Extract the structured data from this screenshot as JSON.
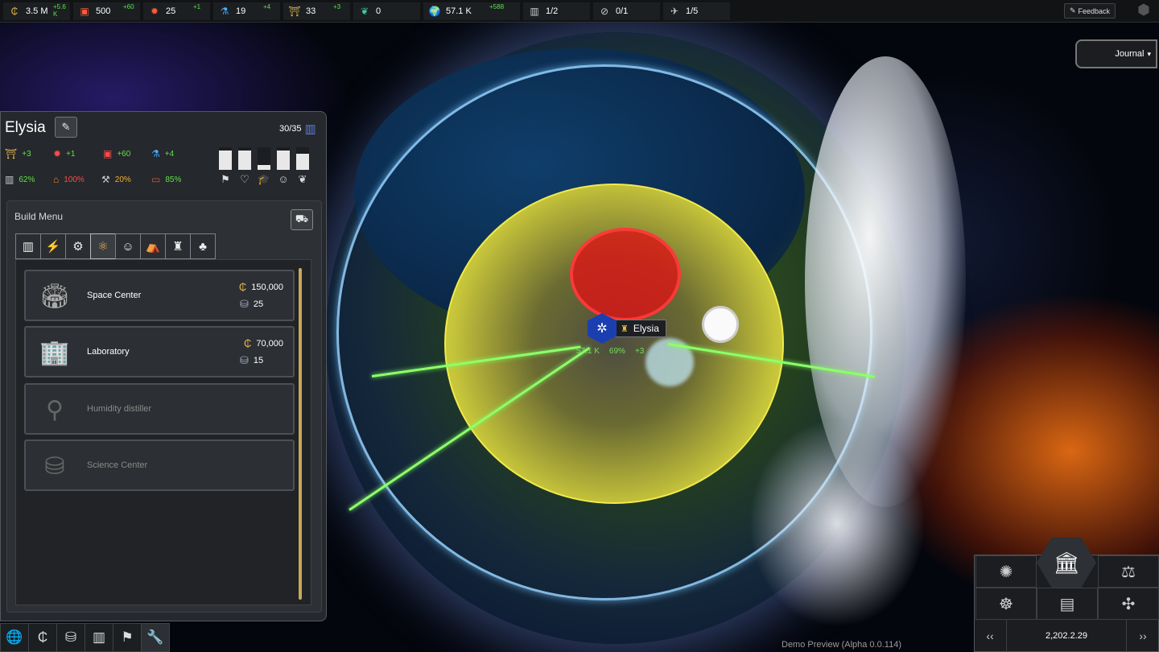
{
  "topbar": {
    "resources": [
      {
        "icon": "credits-icon",
        "glyph": "₵",
        "value": "3.5 M",
        "delta": "+5.6 K",
        "color": "#e6b84a"
      },
      {
        "icon": "materials-icon",
        "glyph": "▣",
        "value": "500",
        "delta": "+60",
        "color": "#ff5a3a"
      },
      {
        "icon": "technology-icon",
        "glyph": "✹",
        "value": "25",
        "delta": "+1",
        "color": "#ff5a3a"
      },
      {
        "icon": "research-icon",
        "glyph": "⚗",
        "value": "19",
        "delta": "+4",
        "color": "#4ab0ff"
      },
      {
        "icon": "influence-icon",
        "glyph": "⛩",
        "value": "33",
        "delta": "+3",
        "color": "#e6b84a"
      },
      {
        "icon": "crops-icon",
        "glyph": "❦",
        "value": "0",
        "delta": "",
        "color": "#3ad0a0"
      },
      {
        "icon": "population-globe-icon",
        "glyph": "🌍",
        "value": "57.1 K",
        "delta": "+588",
        "color": "#5ee04a"
      },
      {
        "icon": "cities-icon",
        "glyph": "▥",
        "value": "1/2",
        "delta": "",
        "color": "#cccccc"
      },
      {
        "icon": "colonies-icon",
        "glyph": "⊘",
        "value": "0/1",
        "delta": "",
        "color": "#cccccc"
      },
      {
        "icon": "ships-icon",
        "glyph": "✈",
        "value": "1/5",
        "delta": "",
        "color": "#cccccc"
      }
    ],
    "feedback_label": "Feedback"
  },
  "journal_label": "Journal",
  "city_tag": {
    "name": "Elysia",
    "population": "57.1 K",
    "approval": "69%",
    "influence": "+3"
  },
  "panel": {
    "city_name": "Elysia",
    "population": "30/35",
    "stats_row1": [
      {
        "icon": "influence-icon",
        "glyph": "⛩",
        "value": "+3",
        "cls": "g",
        "iconcls": "y"
      },
      {
        "icon": "technology-icon",
        "glyph": "✹",
        "value": "+1",
        "cls": "g",
        "iconcls": "r"
      },
      {
        "icon": "materials-icon",
        "glyph": "▣",
        "value": "+60",
        "cls": "g",
        "iconcls": "r"
      },
      {
        "icon": "research-icon",
        "glyph": "⚗",
        "value": "+4",
        "cls": "g",
        "iconcls": "b"
      }
    ],
    "stats_row2": [
      {
        "icon": "housing-icon",
        "glyph": "▥",
        "value": "62%",
        "cls": "g"
      },
      {
        "icon": "commerce-icon",
        "glyph": "⌂",
        "value": "100%",
        "cls": "r"
      },
      {
        "icon": "industry-icon",
        "glyph": "⚒",
        "value": "20%",
        "cls": "o"
      },
      {
        "icon": "jobs-icon",
        "glyph": "▭",
        "value": "85%",
        "cls": "g"
      }
    ],
    "needs_bars": [
      {
        "icon": "security-icon",
        "glyph": "⚑",
        "level": 0.85
      },
      {
        "icon": "health-icon",
        "glyph": "♡",
        "level": 0.85
      },
      {
        "icon": "education-icon",
        "glyph": "🎓",
        "level": 0.2
      },
      {
        "icon": "entertainment-icon",
        "glyph": "☺",
        "level": 0.85
      },
      {
        "icon": "nature-icon",
        "glyph": "❦",
        "level": 0.7
      }
    ],
    "build_menu_title": "Build Menu",
    "tabs": [
      {
        "icon": "housing-tab-icon",
        "glyph": "▥"
      },
      {
        "icon": "energy-tab-icon",
        "glyph": "⚡"
      },
      {
        "icon": "industry-tab-icon",
        "glyph": "⚙"
      },
      {
        "icon": "science-tab-icon",
        "glyph": "⚛"
      },
      {
        "icon": "entertainment-tab-icon",
        "glyph": "☺"
      },
      {
        "icon": "health-tab-icon",
        "glyph": "⛺"
      },
      {
        "icon": "monument-tab-icon",
        "glyph": "♜"
      },
      {
        "icon": "nature-tab-icon",
        "glyph": "♣"
      }
    ],
    "buildings": [
      {
        "name": "Space Center",
        "credits": "150,000",
        "workers": "25",
        "enabled": true,
        "icon": "space-center-icon",
        "glyph": "🏟"
      },
      {
        "name": "Laboratory",
        "credits": "70,000",
        "workers": "15",
        "enabled": true,
        "icon": "laboratory-icon",
        "glyph": "🏢"
      },
      {
        "name": "Humidity distiller",
        "credits": "",
        "workers": "",
        "enabled": false,
        "icon": "humidity-distiller-icon",
        "glyph": "⚲"
      },
      {
        "name": "Science Center",
        "credits": "",
        "workers": "",
        "enabled": false,
        "icon": "science-center-icon",
        "glyph": "⛁"
      }
    ]
  },
  "bottom_nav": [
    {
      "icon": "planet-icon",
      "glyph": "🌐"
    },
    {
      "icon": "credits-icon",
      "glyph": "₵"
    },
    {
      "icon": "resources-icon",
      "glyph": "⛁"
    },
    {
      "icon": "cities-icon",
      "glyph": "▥"
    },
    {
      "icon": "flags-icon",
      "glyph": "⚑"
    },
    {
      "icon": "build-tools-icon",
      "glyph": "🔧"
    }
  ],
  "right_panel": {
    "buttons": [
      {
        "icon": "society-icon",
        "glyph": "✺"
      },
      {
        "icon": "government-icon",
        "glyph": "🏛"
      },
      {
        "icon": "justice-icon",
        "glyph": "⚖"
      },
      {
        "icon": "diplomacy-icon",
        "glyph": "☸"
      },
      {
        "icon": "budget-icon",
        "glyph": "▤"
      },
      {
        "icon": "research-tree-icon",
        "glyph": "✣"
      }
    ],
    "date": "2,202.2.29",
    "prev_label": "‹‹",
    "next_label": "››"
  },
  "version_text": "Demo Preview (Alpha 0.0.114)"
}
